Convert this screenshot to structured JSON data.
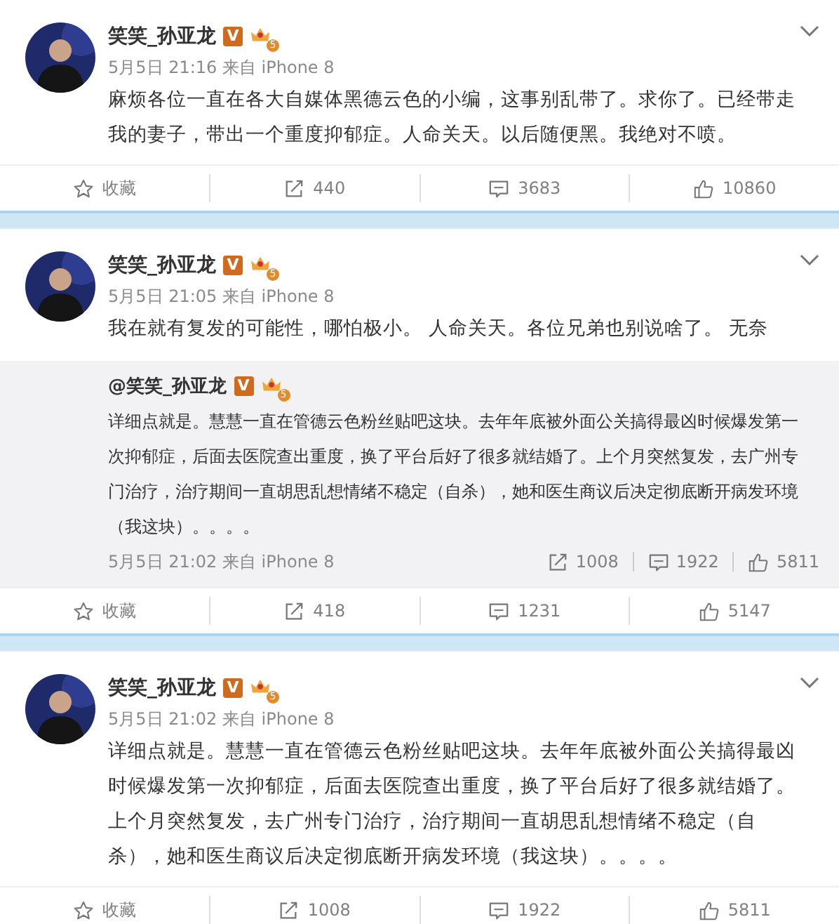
{
  "posts": [
    {
      "author": {
        "name": "笑笑_孙亚龙",
        "verified_mark": "V",
        "crown_level": "5"
      },
      "meta": "5月5日 21:16 来自 iPhone 8",
      "text": "麻烦各位一直在各大自媒体黑德云色的小编，这事别乱带了。求你了。已经带走我的妻子，带出一个重度抑郁症。人命关天。以后随便黑。我绝对不喷。",
      "actions": {
        "favorite": "收藏",
        "reposts": "440",
        "comments": "3683",
        "likes": "10860"
      }
    },
    {
      "author": {
        "name": "笑笑_孙亚龙",
        "verified_mark": "V",
        "crown_level": "5"
      },
      "meta": "5月5日 21:05 来自 iPhone 8",
      "text": "我在就有复发的可能性，哪怕极小。 人命关天。各位兄弟也别说啥了。 无奈",
      "repost": {
        "author": "@笑笑_孙亚龙",
        "verified_mark": "V",
        "crown_level": "5",
        "text": "详细点就是。慧慧一直在管德云色粉丝贴吧这块。去年年底被外面公关搞得最凶时候爆发第一次抑郁症，后面去医院查出重度，换了平台后好了很多就结婚了。上个月突然复发，去广州专门治疗，治疗期间一直胡思乱想情绪不稳定（自杀），她和医生商议后决定彻底断开病发环境（我这块）。。。。",
        "meta": "5月5日 21:02 来自 iPhone 8",
        "reposts": "1008",
        "comments": "1922",
        "likes": "5811"
      },
      "actions": {
        "favorite": "收藏",
        "reposts": "418",
        "comments": "1231",
        "likes": "5147"
      }
    },
    {
      "author": {
        "name": "笑笑_孙亚龙",
        "verified_mark": "V",
        "crown_level": "5"
      },
      "meta": "5月5日 21:02 来自 iPhone 8",
      "text": "详细点就是。慧慧一直在管德云色粉丝贴吧这块。去年年底被外面公关搞得最凶时候爆发第一次抑郁症，后面去医院查出重度，换了平台后好了很多就结婚了。上个月突然复发，去广州专门治疗，治疗期间一直胡思乱想情绪不稳定（自杀），她和医生商议后决定彻底断开病发环境（我这块）。。。。",
      "actions": {
        "favorite": "收藏",
        "reposts": "1008",
        "comments": "1922",
        "likes": "5811"
      }
    }
  ]
}
